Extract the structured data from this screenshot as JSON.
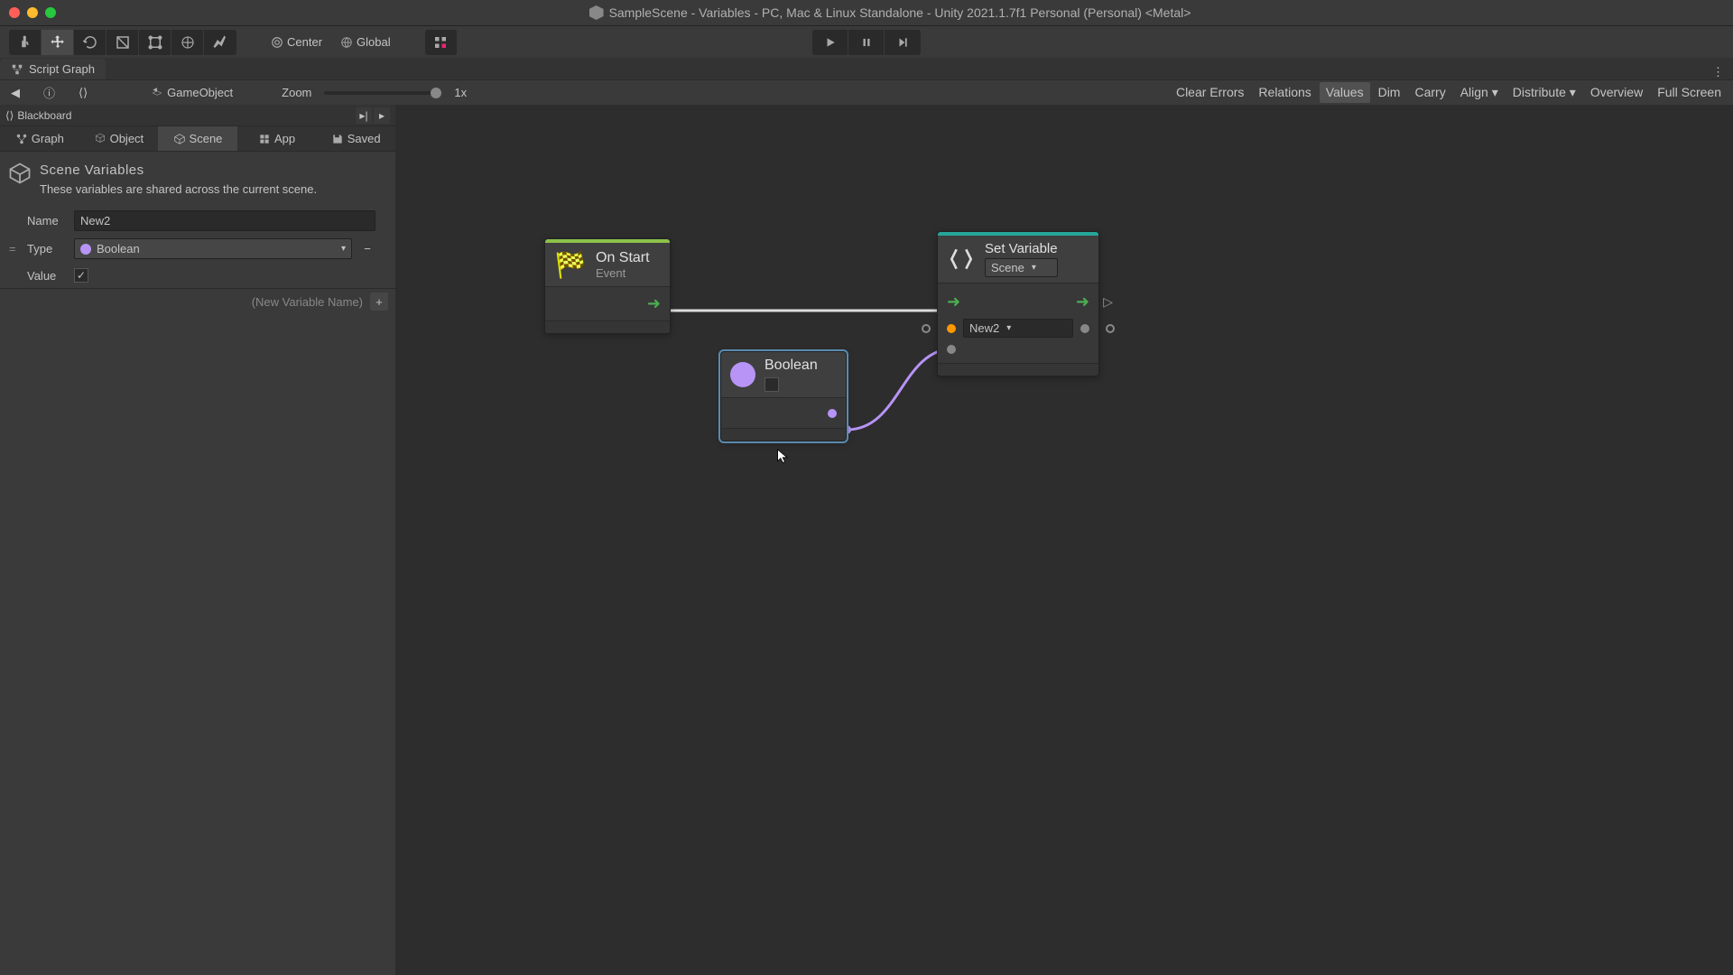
{
  "titlebar": {
    "title": "SampleScene - Variables - PC, Mac & Linux Standalone - Unity 2021.1.7f1 Personal (Personal) <Metal>"
  },
  "toolbar": {
    "pivot": "Center",
    "handle": "Global"
  },
  "tab": {
    "name": "Script Graph"
  },
  "subheader": {
    "gameobject": "GameObject",
    "zoom_label": "Zoom",
    "zoom_value": "1x",
    "buttons": {
      "clear_errors": "Clear Errors",
      "relations": "Relations",
      "values": "Values",
      "dim": "Dim",
      "carry": "Carry",
      "align": "Align",
      "distribute": "Distribute",
      "overview": "Overview",
      "fullscreen": "Full Screen"
    }
  },
  "blackboard": {
    "title": "Blackboard",
    "scopes": {
      "graph": "Graph",
      "object": "Object",
      "scene": "Scene",
      "app": "App",
      "saved": "Saved"
    },
    "panel_title": "Scene Variables",
    "panel_desc": "These variables are shared across the current scene.",
    "var_name_label": "Name",
    "var_name_value": "New2",
    "var_type_label": "Type",
    "var_type_value": "Boolean",
    "var_value_label": "Value",
    "new_var_placeholder": "(New Variable Name)"
  },
  "nodes": {
    "onstart": {
      "title": "On Start",
      "subtitle": "Event"
    },
    "boolean": {
      "title": "Boolean"
    },
    "setvar": {
      "title": "Set Variable",
      "scope": "Scene",
      "varname": "New2"
    }
  }
}
